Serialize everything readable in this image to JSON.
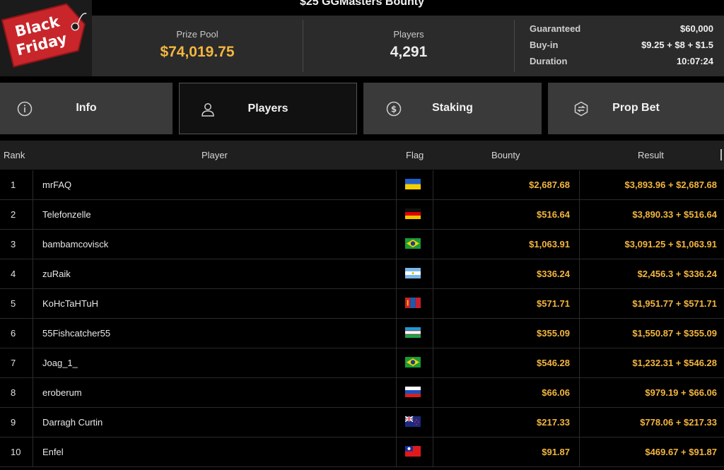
{
  "header": {
    "title": "$25 GGMasters Bounty",
    "badge": {
      "line1": "Black",
      "line2": "Friday"
    }
  },
  "stats": {
    "prize_pool_label": "Prize Pool",
    "prize_pool_value": "$74,019.75",
    "players_label": "Players",
    "players_value": "4,291"
  },
  "details": {
    "guaranteed_label": "Guaranteed",
    "guaranteed_value": "$60,000",
    "buyin_label": "Buy-in",
    "buyin_value": "$9.25 + $8 + $1.5",
    "duration_label": "Duration",
    "duration_value": "10:07:24"
  },
  "tabs": [
    {
      "label": "Info",
      "icon": "info-icon",
      "active": false
    },
    {
      "label": "Players",
      "icon": "user-icon",
      "active": true
    },
    {
      "label": "Staking",
      "icon": "dollar-icon",
      "active": false
    },
    {
      "label": "Prop Bet",
      "icon": "prop-bet-icon",
      "active": false
    }
  ],
  "table": {
    "columns": {
      "rank": "Rank",
      "player": "Player",
      "flag": "Flag",
      "bounty": "Bounty",
      "result": "Result"
    },
    "rows": [
      {
        "rank": "1",
        "player": "mrFAQ",
        "flag": "ukraine",
        "bounty": "$2,687.68",
        "result": "$3,893.96 + $2,687.68"
      },
      {
        "rank": "2",
        "player": "Telefonzelle",
        "flag": "germany",
        "bounty": "$516.64",
        "result": "$3,890.33 + $516.64"
      },
      {
        "rank": "3",
        "player": "bambamcovisck",
        "flag": "brazil",
        "bounty": "$1,063.91",
        "result": "$3,091.25 + $1,063.91"
      },
      {
        "rank": "4",
        "player": "zuRaik",
        "flag": "argentina",
        "bounty": "$336.24",
        "result": "$2,456.3 + $336.24"
      },
      {
        "rank": "5",
        "player": "KoHcTaHTuH",
        "flag": "mongolia",
        "bounty": "$571.71",
        "result": "$1,951.77 + $571.71"
      },
      {
        "rank": "6",
        "player": "55Fishcatcher55",
        "flag": "uzbekistan",
        "bounty": "$355.09",
        "result": "$1,550.87 + $355.09"
      },
      {
        "rank": "7",
        "player": "Joag_1_",
        "flag": "brazil",
        "bounty": "$546.28",
        "result": "$1,232.31 + $546.28"
      },
      {
        "rank": "8",
        "player": "eroberum",
        "flag": "russia",
        "bounty": "$66.06",
        "result": "$979.19 + $66.06"
      },
      {
        "rank": "9",
        "player": "Darragh Curtin",
        "flag": "new-zealand",
        "bounty": "$217.33",
        "result": "$778.06 + $217.33"
      },
      {
        "rank": "10",
        "player": "Enfel",
        "flag": "taiwan",
        "bounty": "$91.87",
        "result": "$469.67 + $91.87"
      }
    ]
  },
  "colors": {
    "accent_gold": "#f4b63f",
    "badge_red": "#c8262b",
    "active_tab_bg": "#111111",
    "tab_bg": "#3a3a3a"
  }
}
